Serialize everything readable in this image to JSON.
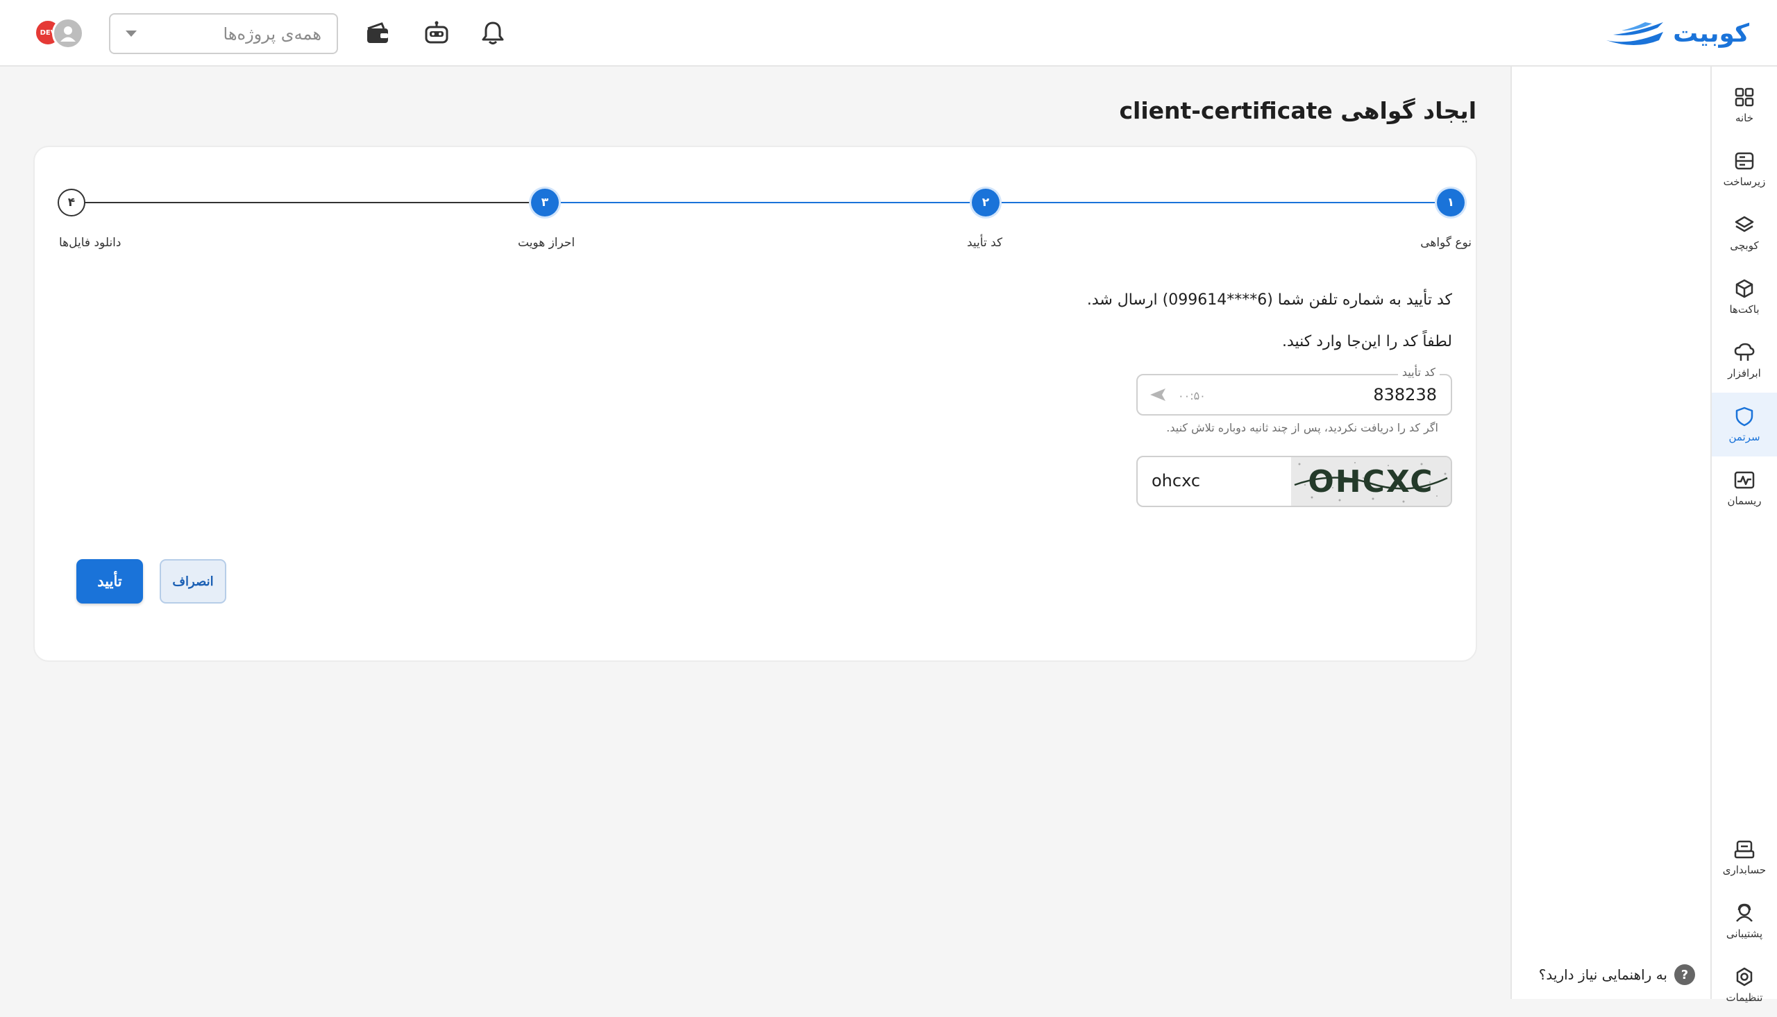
{
  "brand": {
    "name": "کوبیت",
    "accent": "#1a73d9"
  },
  "header": {
    "project_select_placeholder": "همه‌ی پروژه‌ها",
    "icons": [
      "bell-icon",
      "robot-icon",
      "wallet-icon",
      "user-avatar",
      "status-badge"
    ],
    "avatar_badge_text": "DEV"
  },
  "sidebar": {
    "items": [
      {
        "label": "خانه",
        "icon": "grid-icon",
        "active": false
      },
      {
        "label": "زیرساخت",
        "icon": "server-icon",
        "active": false
      },
      {
        "label": "کوبچی",
        "icon": "layers-icon",
        "active": false
      },
      {
        "label": "باکت‌ها",
        "icon": "box-icon",
        "active": false
      },
      {
        "label": "ابرافزار",
        "icon": "cloud-app-icon",
        "active": false
      },
      {
        "label": "سرتمن",
        "icon": "shield-icon",
        "active": true
      },
      {
        "label": "ریسمان",
        "icon": "chart-icon",
        "active": false
      },
      {
        "label": "حسابداری",
        "icon": "accounting-icon",
        "active": false
      },
      {
        "label": "پشتیبانی",
        "icon": "support-icon",
        "active": false
      },
      {
        "label": "تنظیمات",
        "icon": "settings-icon",
        "active": false
      }
    ]
  },
  "help": {
    "text": "به راهنمایی نیاز دارید؟",
    "icon": "?"
  },
  "page": {
    "title": "ایجاد گواهی client-certificate"
  },
  "stepper": {
    "steps": [
      {
        "number": "۱",
        "label": "نوع گواهی",
        "state": "done"
      },
      {
        "number": "۲",
        "label": "کد تأیید",
        "state": "done"
      },
      {
        "number": "۳",
        "label": "احراز هویت",
        "state": "done"
      },
      {
        "number": "۴",
        "label": "دانلود فایل‌ها",
        "state": "todo"
      }
    ]
  },
  "verification": {
    "message": "کد تأیید به شماره تلفن شما (6****099614) ارسال شد.",
    "instruction": "لطفاً کد را این‌جا وارد کنید.",
    "field_label": "کد تأیید",
    "field_value": "838238",
    "timer": "۰۰:۵۰",
    "hint": "اگر کد را دریافت نکردید، پس از چند ثانیه دوباره تلاش کنید."
  },
  "captcha": {
    "image_text": "OHCXC",
    "input_value": "ohcxc"
  },
  "actions": {
    "confirm_label": "تأیید",
    "cancel_label": "انصراف"
  }
}
